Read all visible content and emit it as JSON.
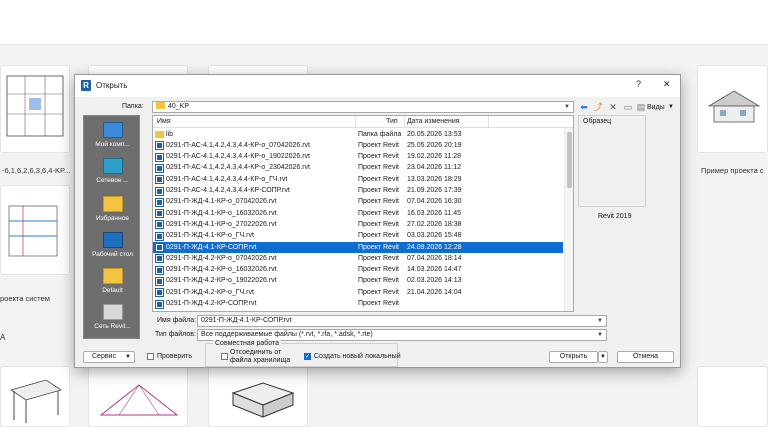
{
  "background": {
    "cards": [
      {
        "caption": "-6,1,6,2,6,3,6,4-KP..."
      },
      {
        "caption": "Пример проекта с"
      },
      {
        "caption": "роекта систем"
      }
    ],
    "section_label": "A"
  },
  "dialog": {
    "title": "Открыть",
    "help": "?",
    "close": "✕",
    "folder_label": "Папка:",
    "folder_value": "40_KP",
    "views_label": "Виды",
    "places": [
      {
        "label": "Мой комп..."
      },
      {
        "label": "Сетевое ..."
      },
      {
        "label": "Избранное"
      },
      {
        "label": "Рабочий стол"
      },
      {
        "label": "Default"
      },
      {
        "label": "Сеть Revit..."
      }
    ],
    "columns": {
      "name": "Имя",
      "type": "Тип",
      "date": "Дата изменения"
    },
    "files": [
      {
        "name": "lib",
        "type": "Папка файла",
        "date": "20.05.2026 13:53",
        "icon": "folder",
        "selected": false
      },
      {
        "name": "0291-П-АС-4.1,4.2,4.3,4.4-КР-о_07042026.rvt",
        "type": "Проект Revit",
        "date": "25.05.2026 20:19",
        "icon": "revit",
        "selected": false
      },
      {
        "name": "0291-П-АС-4.1,4.2,4.3,4.4-КР-о_19022026.rvt",
        "type": "Проект Revit",
        "date": "19.02.2026 11:28",
        "icon": "revit",
        "selected": false
      },
      {
        "name": "0291-П-АС-4.1,4.2,4.3,4.4-КР-о_23042026.rvt",
        "type": "Проект Revit",
        "date": "23.04.2026 11:12",
        "icon": "revit",
        "selected": false
      },
      {
        "name": "0291-П-АС-4.1,4.2,4.3,4.4-КР-о_ГЧ.rvt",
        "type": "Проект Revit",
        "date": "13.03.2026 18:29",
        "icon": "revit",
        "selected": false
      },
      {
        "name": "0291-П-АС-4.1,4.2,4.3,4.4-КР-СОПР.rvt",
        "type": "Проект Revit",
        "date": "21.09.2026 17:39",
        "icon": "revit",
        "selected": false
      },
      {
        "name": "0291-П-ЖД-4.1-КР-о_07042026.rvt",
        "type": "Проект Revit",
        "date": "07.04.2026 16:30",
        "icon": "revit",
        "selected": false
      },
      {
        "name": "0291-П-ЖД-4.1-КР-о_16032026.rvt",
        "type": "Проект Revit",
        "date": "16.03.2026 11:45",
        "icon": "revit",
        "selected": false
      },
      {
        "name": "0291-П-ЖД-4.1-КР-о_27022026.rvt",
        "type": "Проект Revit",
        "date": "27.02.2026 18:38",
        "icon": "revit",
        "selected": false
      },
      {
        "name": "0291-П-ЖД-4.1-КР-о_ГЧ.rvt",
        "type": "Проект Revit",
        "date": "03.03.2026 15:48",
        "icon": "revit",
        "selected": false
      },
      {
        "name": "0291-П-ЖД-4.1-КР-СОПР.rvt",
        "type": "Проект Revit",
        "date": "24.09.2026 12:28",
        "icon": "revit",
        "selected": true
      },
      {
        "name": "0291-П-ЖД-4.2-КР-о_07042026.rvt",
        "type": "Проект Revit",
        "date": "07.04.2026 18:14",
        "icon": "revit",
        "selected": false
      },
      {
        "name": "0291-П-ЖД-4.2-КР-о_16032026.rvt",
        "type": "Проект Revit",
        "date": "14.03.2026 14:47",
        "icon": "revit",
        "selected": false
      },
      {
        "name": "0291-П-ЖД-4.2-КР-о_19022026.rvt",
        "type": "Проект Revit",
        "date": "02.03.2026 14:13",
        "icon": "revit",
        "selected": false
      },
      {
        "name": "0291-П-ЖД-4.2-КР-о_ГЧ.rvt",
        "type": "Проект Revit",
        "date": "21.04.2026 14:04",
        "icon": "revit",
        "selected": false
      },
      {
        "name": "0291-П-ЖД-4.2-КР-СОПР.rvt",
        "type": "Проект Revit",
        "date": "",
        "icon": "revit",
        "selected": false
      }
    ],
    "preview_label": "Образец",
    "preview_version": "Revit 2019",
    "filename_label": "Имя файла:",
    "filename_value": "0291-П-ЖД-4.1-КР-СОПР.rvt",
    "filetype_label": "Тип файлов:",
    "filetype_value": "Все поддерживаемые файлы (*.rvt, *.rfa, *.adsk, *.rte)",
    "service_button": "Сервис",
    "check_label": "Проверить",
    "worksharing_title": "Совместная работа",
    "detach_label": "Отсоединить от файла хранилища",
    "create_local_label": "Создать новый локальный",
    "open_button": "Открыть",
    "cancel_button": "Отмена"
  },
  "colors": {
    "selection": "#0f6dd1",
    "revit_icon": "#1f5fa8",
    "folder": "#f3c343"
  }
}
